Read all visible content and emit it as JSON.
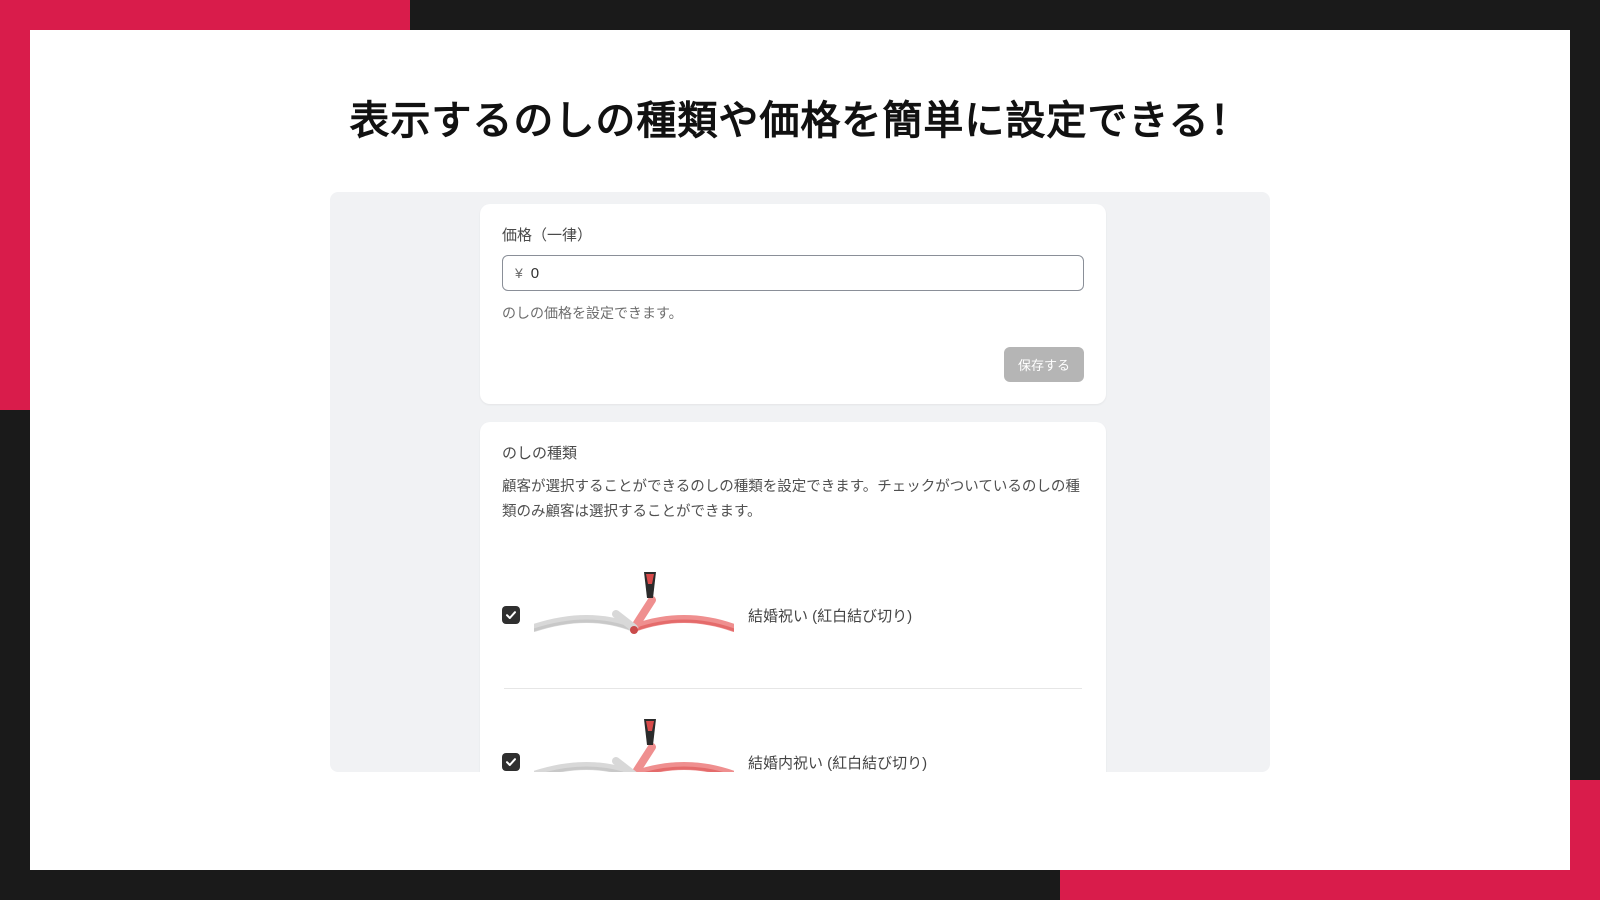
{
  "headline": "表示するのしの種類や価格を簡単に設定できる！",
  "price_card": {
    "label": "価格（一律）",
    "currency": "¥",
    "value": "0",
    "help": "のしの価格を設定できます。",
    "save_label": "保存する"
  },
  "types_card": {
    "title": "のしの種類",
    "description": "顧客が選択することができるのしの種類を設定できます。チェックがついているのしの種類のみ顧客は選択することができます。",
    "items": [
      {
        "checked": true,
        "label": "結婚祝い (紅白結び切り)"
      },
      {
        "checked": true,
        "label": "結婚内祝い (紅白結び切り)"
      }
    ]
  }
}
